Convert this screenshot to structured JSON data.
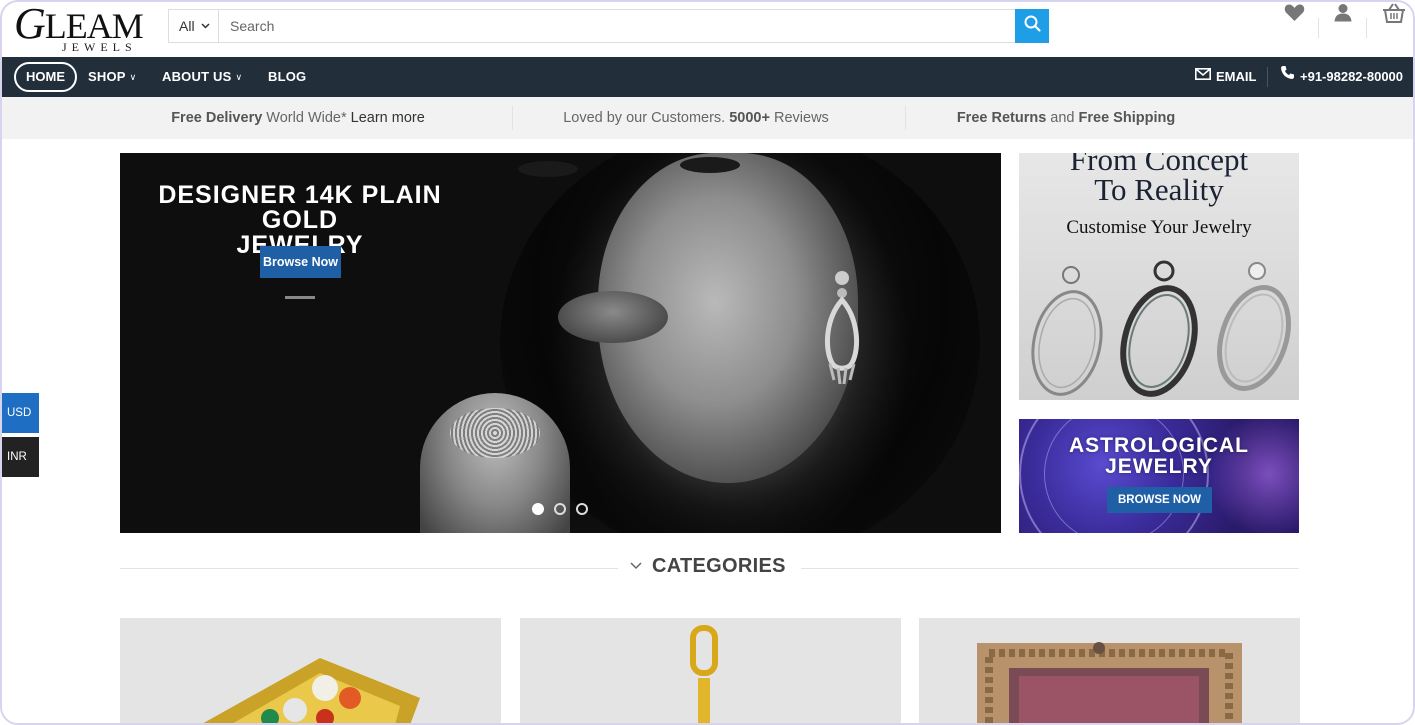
{
  "header": {
    "logo_main": "LEAM",
    "logo_g": "G",
    "logo_sub": "JEWELS",
    "search_category": "All",
    "search_placeholder": "Search"
  },
  "nav": {
    "home": "HOME",
    "shop": "SHOP",
    "about": "ABOUT US",
    "blog": "BLOG",
    "email": "EMAIL",
    "phone": "+91-98282-80000"
  },
  "infobar": {
    "item1_bold": "Free Delivery",
    "item1_text": " World Wide* ",
    "item1_link": "Learn more",
    "item2_text": "Loved by our Customers. ",
    "item2_bold": "5000+",
    "item2_tail": " Reviews",
    "item3_bold1": "Free Returns",
    "item3_mid": " and ",
    "item3_bold2": "Free Shipping"
  },
  "hero": {
    "title_line1": "DESIGNER 14K PLAIN GOLD",
    "title_line2": "JEWELRY",
    "button": "Browse Now",
    "slides": 3,
    "active_slide": 1
  },
  "banner1": {
    "title_line1": "From Concept",
    "title_line2": "To Reality",
    "subtitle": "Customise Your Jewelry"
  },
  "banner2": {
    "title_line1": "ASTROLOGICAL",
    "title_line2": "JEWELRY",
    "button": "BROWSE NOW"
  },
  "currency": {
    "usd": "USD",
    "inr": "INR"
  },
  "categories": {
    "heading": "CATEGORIES"
  },
  "colors": {
    "nav_bg": "#232e3b",
    "accent_blue": "#1e9ee6",
    "button_blue": "#1e5fa6"
  }
}
